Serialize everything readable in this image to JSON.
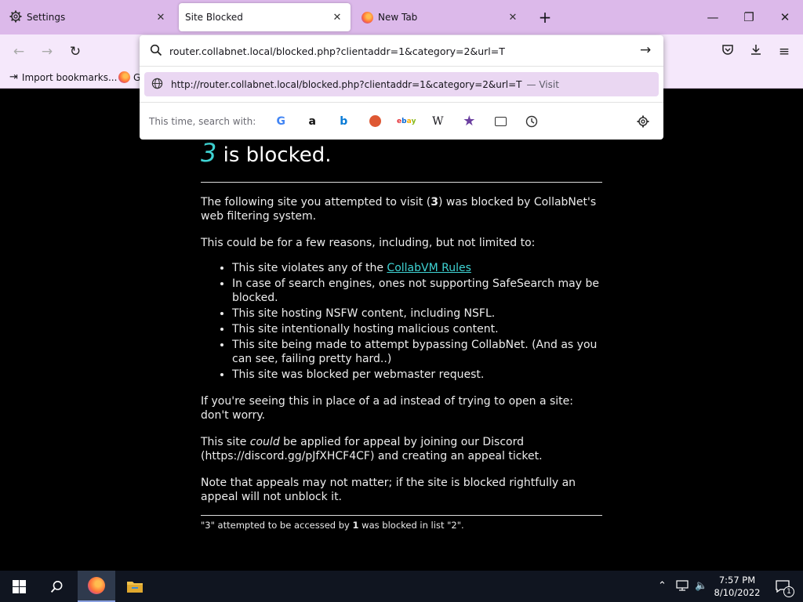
{
  "tabs": [
    {
      "label": "Settings"
    },
    {
      "label": "Site Blocked"
    },
    {
      "label": "New Tab"
    }
  ],
  "urlbar": {
    "value": "router.collabnet.local/blocked.php?clientaddr=1&category=2&url=T",
    "suggestion_url": "http://router.collabnet.local/blocked.php?clientaddr=1&category=2&url=T",
    "suggestion_action": "— Visit",
    "search_with_label": "This time, search with:"
  },
  "bookmarks": {
    "import": "Import bookmarks...",
    "second": "G"
  },
  "page": {
    "site_name": "3",
    "heading_rest": "is blocked.",
    "intro_pre": "The following site you attempted to visit (",
    "intro_site": "3",
    "intro_post": ") was blocked by CollabNet's web filtering system.",
    "reasons_intro": "This could be for a few reasons, including, but not limited to:",
    "reason1_pre": "This site violates any of the ",
    "reason1_link": "CollabVM Rules",
    "reasons": [
      "In case of search engines, ones not supporting SafeSearch may be blocked.",
      "This site hosting NSFW content, including NSFL.",
      "This site intentionally hosting malicious content.",
      "This site being made to attempt bypassing CollabNet. (And as you can see, failing pretty hard..)",
      "This site was blocked per webmaster request."
    ],
    "ad_note": "If you're seeing this in place of a ad instead of trying to open a site: don't worry.",
    "appeal_pre": "This site ",
    "appeal_em": "could",
    "appeal_post": " be applied for appeal by joining our Discord (https://discord.gg/pJfXHCF4CF) and creating an appeal ticket.",
    "appeal_note": "Note that appeals may not matter; if the site is blocked rightfully an appeal will not unblock it.",
    "footer_pre": "\"3\" attempted to be accessed by ",
    "footer_client": "1",
    "footer_post": " was blocked in list \"2\"."
  },
  "taskbar": {
    "time": "7:57 PM",
    "date": "8/10/2022",
    "notification_count": "1"
  },
  "colors": {
    "tab_strip": "#dcb9ea",
    "toolbar": "#f5e8fb",
    "accent_link": "#3fd4d4",
    "page_bg": "#000000"
  }
}
